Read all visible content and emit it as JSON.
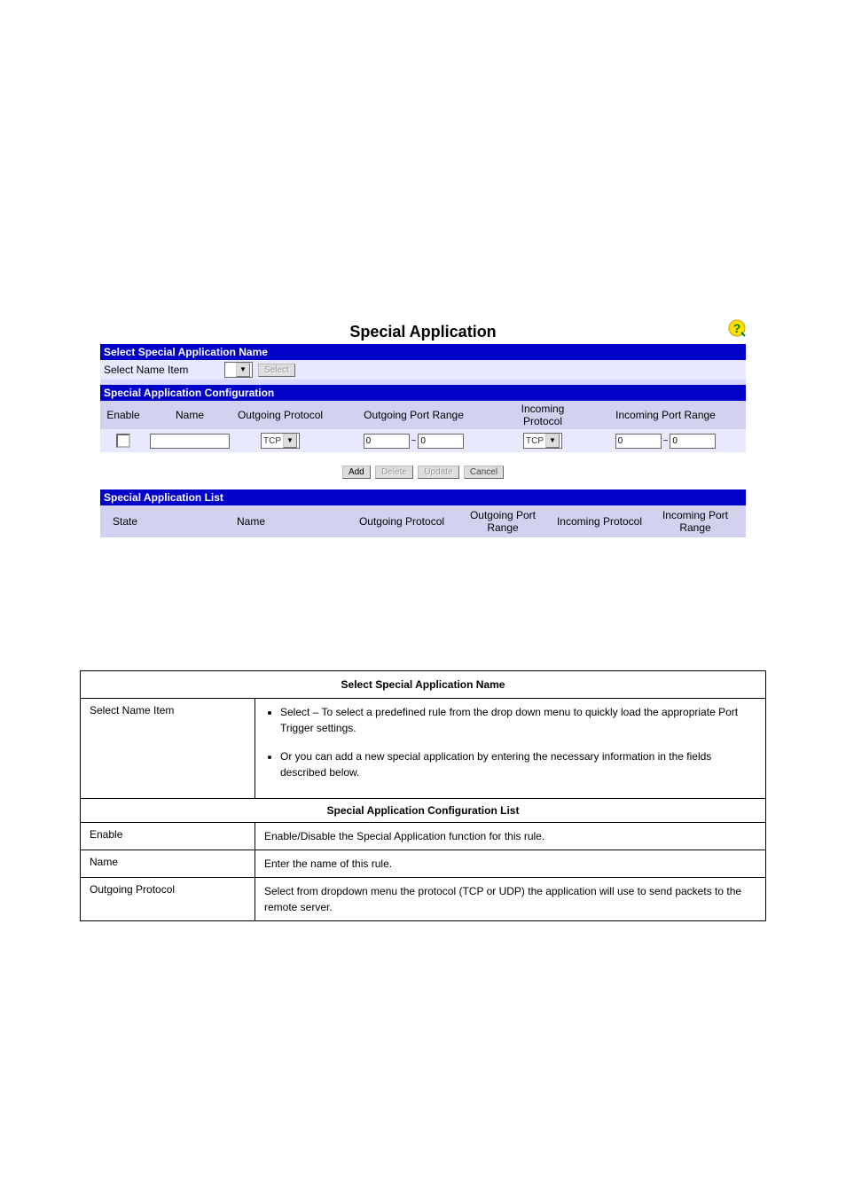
{
  "screenshot": {
    "title": "Special Application",
    "bar1": "Select Special Application Name",
    "selectNameLabel": "Select Name Item",
    "selectBtn": "Select",
    "bar2": "Special Application Configuration",
    "cfgHeaders": {
      "enable": "Enable",
      "name": "Name",
      "outProto": "Outgoing Protocol",
      "outRange": "Outgoing Port Range",
      "inProto": "Incoming Protocol",
      "inRange": "Incoming Port Range"
    },
    "cfgValues": {
      "outProto": "TCP",
      "outFrom": "0",
      "outTo": "0",
      "inProto": "TCP",
      "inFrom": "0",
      "inTo": "0",
      "tilde": "~"
    },
    "buttons": {
      "add": "Add",
      "delete": "Delete",
      "update": "Update",
      "cancel": "Cancel"
    },
    "bar3": "Special Application List",
    "listHeaders": {
      "state": "State",
      "name": "Name",
      "outProto": "Outgoing Protocol",
      "outRange": "Outgoing Port Range",
      "inProto": "Incoming Protocol",
      "inRange": "Incoming Port Range"
    }
  },
  "descTable": {
    "topHeader": "Select Special Application Name",
    "r1Label": "Select Name Item",
    "r1b1": "Select – To select a predefined rule from the drop down menu to quickly load the appropriate Port Trigger settings.",
    "r1b2": "Or you can add a new special application by entering the necessary information in the fields described below.",
    "subHeader": "Special Application Configuration List",
    "r2Label": "Enable",
    "r2Desc": "Enable/Disable the Special Application function for this rule.",
    "r3Label": "Name",
    "r3Desc": "Enter the name of this rule.",
    "r4Label": "Outgoing Protocol",
    "r4Desc": "Select from dropdown menu the protocol (TCP or UDP) the application will use to send packets to the remote server."
  }
}
